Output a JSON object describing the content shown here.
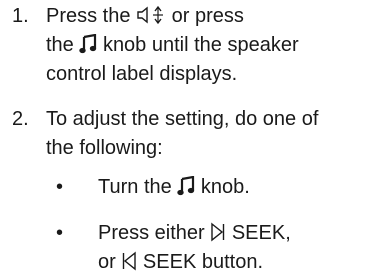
{
  "steps": [
    {
      "number": "1.",
      "line1_a": "Press the",
      "line1_b": "or press",
      "line2_a": "the",
      "line2_b": "knob until the speaker",
      "line3": "control label displays."
    },
    {
      "number": "2.",
      "line1": "To adjust the setting, do one of",
      "line2": "the following:"
    }
  ],
  "bullets": [
    {
      "symbol": "•",
      "line1_a": "Turn the",
      "line1_b": "knob."
    },
    {
      "symbol": "•",
      "line1_a": "Press either",
      "line1_b": "SEEK,",
      "line2_a": "or",
      "line2_b": "SEEK button."
    }
  ],
  "icons": {
    "speaker_adjust": "speaker-adjust-icon",
    "music_note": "music-note-icon",
    "seek_forward": "seek-forward-icon",
    "seek_back": "seek-back-icon"
  }
}
